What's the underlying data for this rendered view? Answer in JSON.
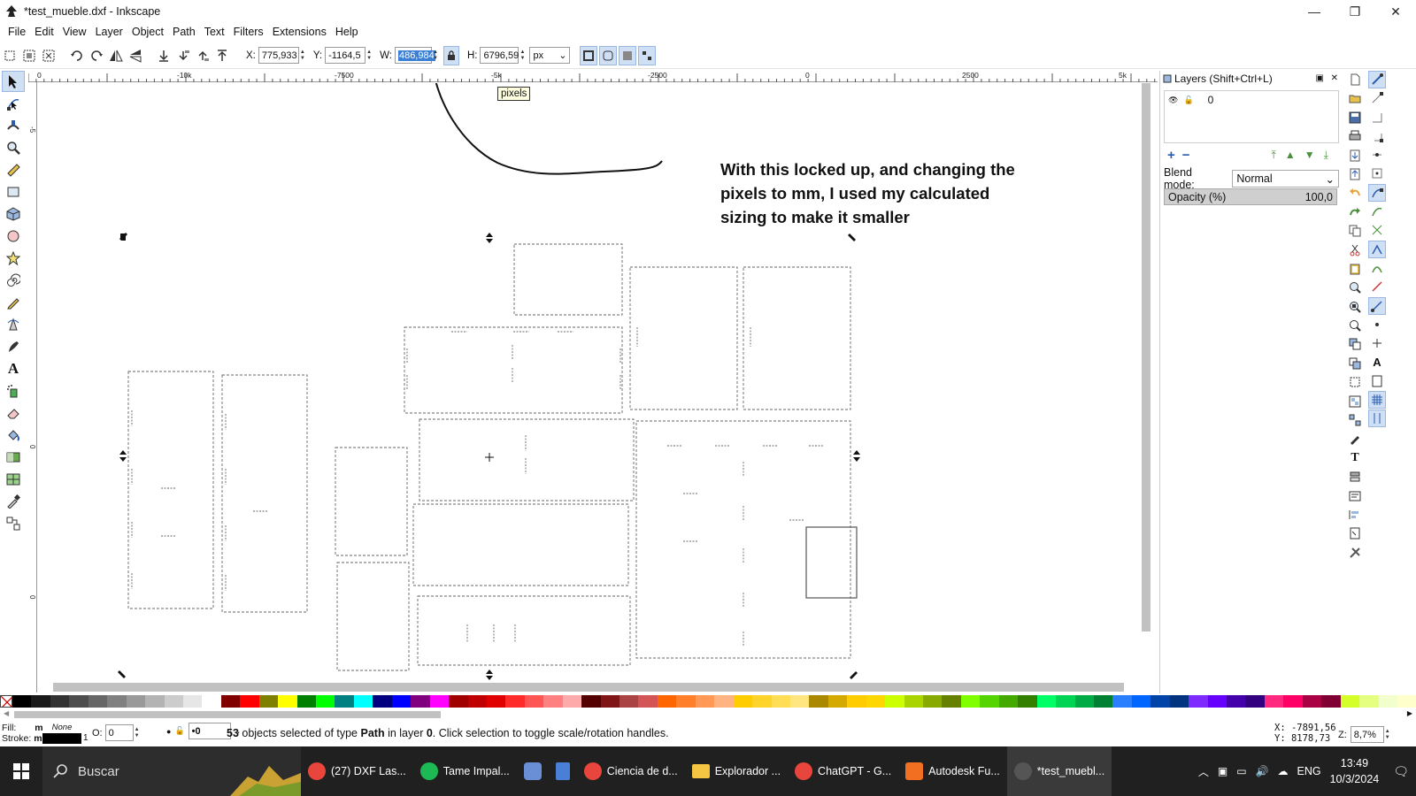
{
  "window": {
    "title": "*test_mueble.dxf - Inkscape",
    "controls": [
      "—",
      "❐",
      "✕"
    ]
  },
  "menu": [
    "File",
    "Edit",
    "View",
    "Layer",
    "Object",
    "Path",
    "Text",
    "Filters",
    "Extensions",
    "Help"
  ],
  "toolbar": {
    "x_label": "X:",
    "x_value": "775,933",
    "y_label": "Y:",
    "y_value": "-1164,5",
    "w_label": "W:",
    "w_value": "486,984",
    "h_label": "H:",
    "h_value": "6796,59",
    "unit": "px"
  },
  "ruler": {
    "h_labels": [
      "0",
      "-10k",
      "-7500",
      "-5k",
      "-2500",
      "0",
      "2500",
      "5k"
    ],
    "v_labels": [
      "-5",
      "0",
      "0"
    ]
  },
  "tooltip": {
    "text": "pixels"
  },
  "annotation": {
    "text": "With this locked up, and changing the pixels to mm, I used my calculated sizing to make it smaller"
  },
  "layers_panel": {
    "title": "Layers (Shift+Ctrl+L)",
    "layer_name": "0",
    "blend_label": "Blend mode:",
    "blend_value": "Normal",
    "opacity_label": "Opacity (%)",
    "opacity_value": "100,0"
  },
  "palette_colors": [
    "#000000",
    "#1a1a1a",
    "#333333",
    "#4d4d4d",
    "#666666",
    "#808080",
    "#999999",
    "#b3b3b3",
    "#cccccc",
    "#e6e6e6",
    "#ffffff",
    "#800000",
    "#ff0000",
    "#808000",
    "#ffff00",
    "#008000",
    "#00ff00",
    "#008080",
    "#00ffff",
    "#000080",
    "#0000ff",
    "#800080",
    "#ff00ff",
    "#a00000",
    "#c00000",
    "#e00000",
    "#ff2a2a",
    "#ff5555",
    "#ff8080",
    "#ffaaaa",
    "#550000",
    "#801515",
    "#aa4444",
    "#d45555",
    "#ff6600",
    "#ff7f2a",
    "#ff9955",
    "#ffb380",
    "#ffcc00",
    "#ffd42a",
    "#ffdd55",
    "#ffe680",
    "#aa8800",
    "#d4aa00",
    "#ffcc00",
    "#ffd700",
    "#ccff00",
    "#aad400",
    "#88aa00",
    "#668000",
    "#80ff00",
    "#55d400",
    "#44aa00",
    "#338000",
    "#00ff66",
    "#00d455",
    "#00aa44",
    "#008033",
    "#2a7fff",
    "#0066ff",
    "#0044aa",
    "#003380",
    "#7f2aff",
    "#6600ff",
    "#4400aa",
    "#330080",
    "#ff2a7f",
    "#ff0066",
    "#aa0044",
    "#800033",
    "#d4ff2a",
    "#e5ff80",
    "#f2ffcc",
    "#ffffcc"
  ],
  "status": {
    "fill_label": "Fill:",
    "fill_value": "m",
    "fill_none": "None",
    "stroke_label": "Stroke:",
    "stroke_value": "m",
    "stroke_width": "1",
    "o_label": "O:",
    "o_value": "0",
    "layer_value": "•0",
    "count": "53",
    "msg_objects": " objects selected of type ",
    "msg_type": "Path",
    "msg_in_layer": " in layer ",
    "msg_layer": "0",
    "msg_tail": ". Click selection to toggle scale/rotation handles.",
    "coord_x": "X: -7891,56",
    "coord_y": "Y:  8178,73",
    "zoom_label": "Z:",
    "zoom_value": "8,7%"
  },
  "taskbar": {
    "search_text": "Buscar",
    "apps": [
      {
        "label": "(27) DXF Las...",
        "color": "#e8453c"
      },
      {
        "label": "Tame Impal...",
        "color": "#1db954"
      },
      {
        "label": "",
        "color": "#6b8fd6"
      },
      {
        "label": "",
        "color": "#4a7fd8"
      },
      {
        "label": "Ciencia de d...",
        "color": "#e8453c"
      },
      {
        "label": "Explorador ...",
        "color": "#f4c542"
      },
      {
        "label": "ChatGPT - G...",
        "color": "#e8453c"
      },
      {
        "label": "Autodesk Fu...",
        "color": "#f26f21"
      },
      {
        "label": "*test_muebl...",
        "color": "#555555"
      }
    ],
    "lang": "ENG",
    "time": "13:49",
    "date": "10/3/2024"
  }
}
